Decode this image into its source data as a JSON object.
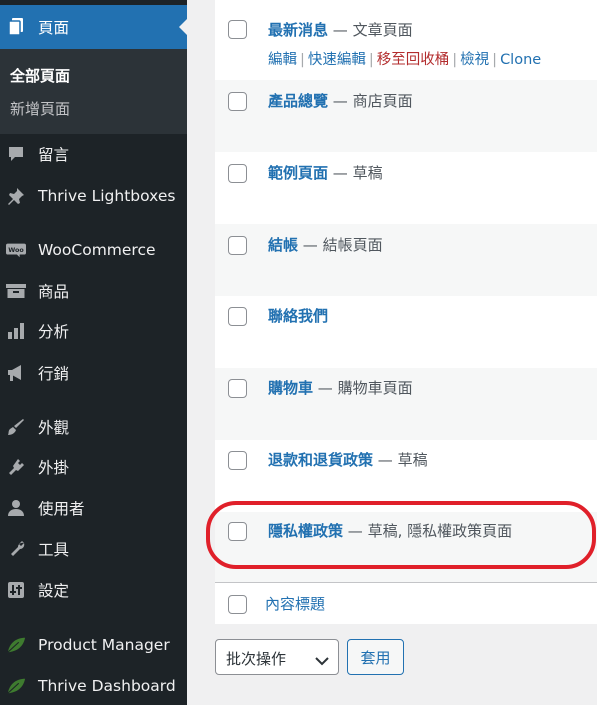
{
  "sidebar": {
    "pages_label": "頁面",
    "submenu": [
      "全部頁面",
      "新增頁面"
    ],
    "items": [
      {
        "label": "留言",
        "icon": "comments-icon"
      },
      {
        "label": "Thrive Lightboxes",
        "icon": "pin-icon"
      },
      {
        "label": "WooCommerce",
        "icon": "woocommerce-icon"
      },
      {
        "label": "商品",
        "icon": "archive-box-icon"
      },
      {
        "label": "分析",
        "icon": "bar-chart-icon"
      },
      {
        "label": "行銷",
        "icon": "megaphone-icon"
      },
      {
        "label": "外觀",
        "icon": "paintbrush-icon"
      },
      {
        "label": "外掛",
        "icon": "plug-icon"
      },
      {
        "label": "使用者",
        "icon": "user-icon"
      },
      {
        "label": "工具",
        "icon": "wrench-icon"
      },
      {
        "label": "設定",
        "icon": "settings-sliders-icon"
      },
      {
        "label": "Product Manager",
        "icon": "leaf-icon"
      },
      {
        "label": "Thrive Dashboard",
        "icon": "leaf-icon"
      }
    ]
  },
  "rows": [
    {
      "title": "最新消息",
      "state": "— 文章頁面"
    },
    {
      "title": "產品總覽",
      "state": "— 商店頁面"
    },
    {
      "title": "範例頁面",
      "state": "— 草稿"
    },
    {
      "title": "結帳",
      "state": "— 結帳頁面"
    },
    {
      "title": "聯絡我們",
      "state": ""
    },
    {
      "title": "購物車",
      "state": "— 購物車頁面"
    },
    {
      "title": "退款和退貨政策",
      "state": "— 草稿"
    },
    {
      "title": "隱私權政策",
      "state": "— 草稿, 隱私權政策頁面"
    }
  ],
  "row_actions": {
    "edit": "編輯",
    "quick_edit": "快速編輯",
    "trash": "移至回收桶",
    "view": "檢視",
    "clone": "Clone",
    "separator": "|"
  },
  "footer": {
    "column_title": "內容標題"
  },
  "bulk": {
    "selected": "批次操作",
    "apply": "套用"
  },
  "colors": {
    "sidebar_bg": "#1d2327",
    "accent": "#2271b1",
    "highlight": "#e0202a"
  }
}
